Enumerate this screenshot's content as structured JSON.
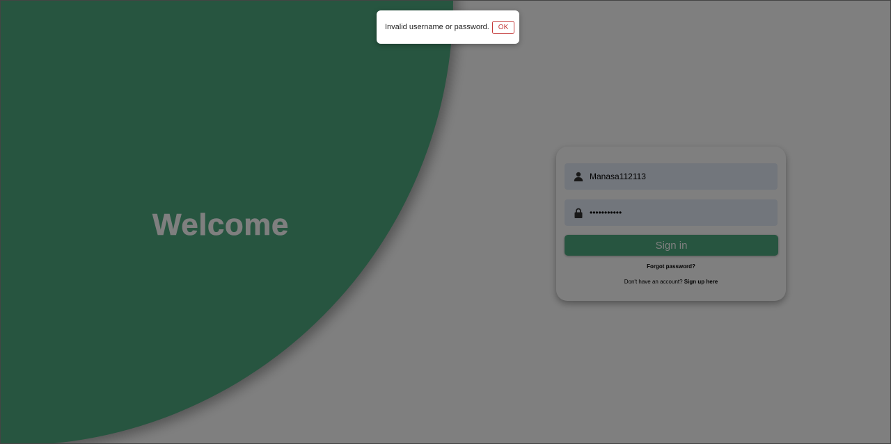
{
  "welcome": {
    "heading": "Welcome"
  },
  "login": {
    "username_value": "Manasa112113",
    "password_value": "•••••••••••",
    "signin_label": "Sign in",
    "forgot_label": "Forgot password?",
    "no_account_text": "Don't have an account?",
    "signup_link_label": "Sign up here"
  },
  "alert": {
    "message": "Invalid username or password.",
    "ok_label": "OK"
  },
  "colors": {
    "accent_green": "#4eaa80",
    "field_bg": "#e4ecf8",
    "alert_ok_red": "#c43a3a"
  },
  "icons": {
    "username": "user-icon",
    "password": "lock-icon"
  }
}
